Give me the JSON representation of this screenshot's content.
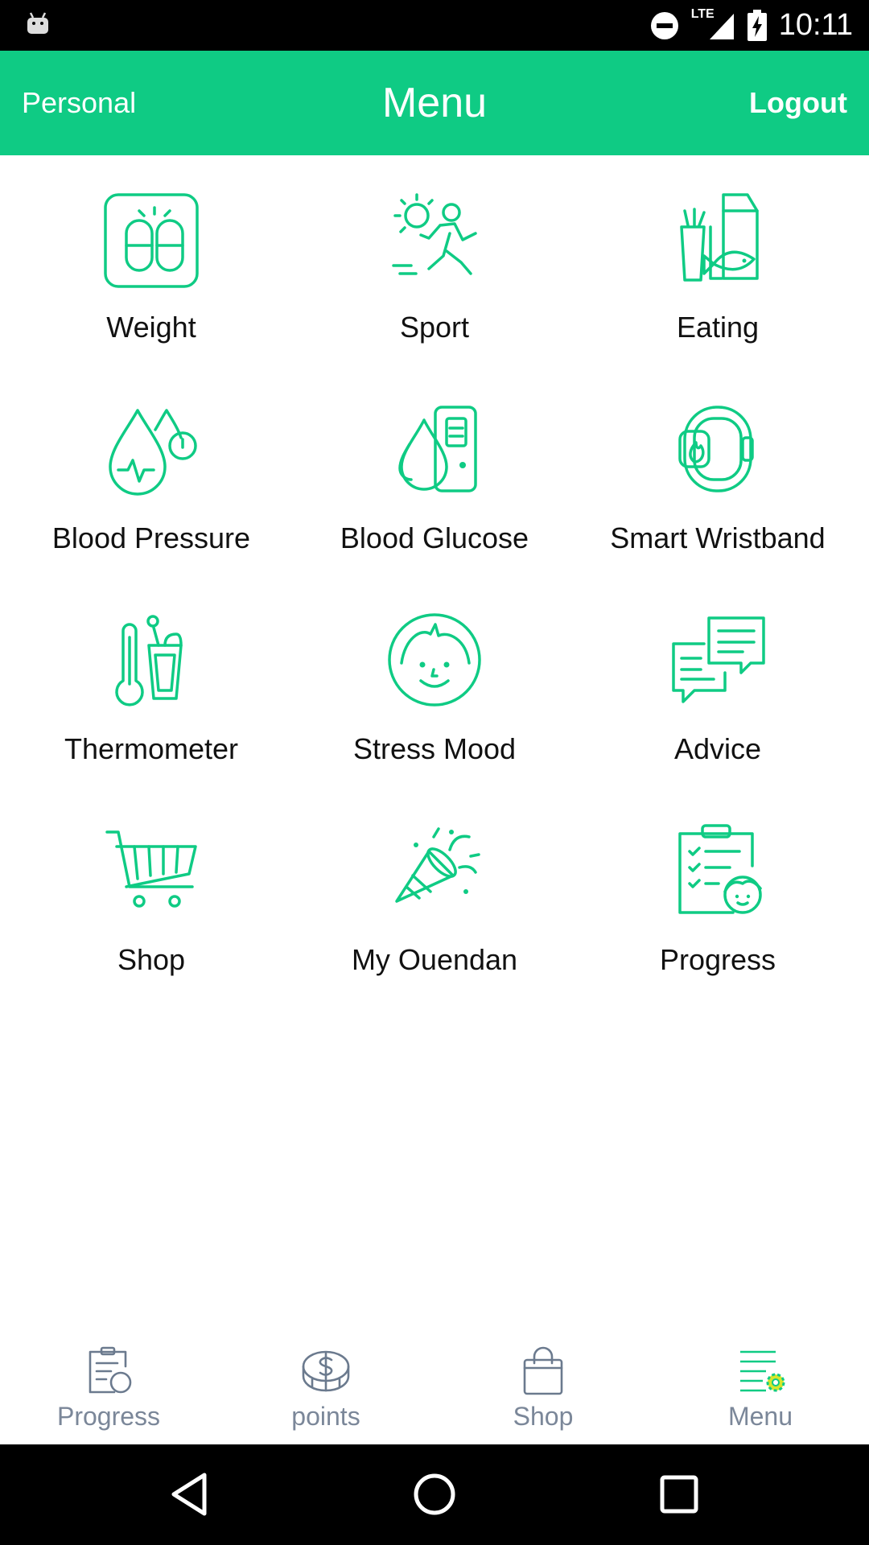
{
  "status_bar": {
    "time": "10:11",
    "network": "LTE"
  },
  "header": {
    "left_label": "Personal",
    "title": "Menu",
    "right_label": "Logout"
  },
  "menu_items": [
    {
      "label": "Weight",
      "icon": "scale-icon"
    },
    {
      "label": "Sport",
      "icon": "running-person-icon"
    },
    {
      "label": "Eating",
      "icon": "groceries-icon"
    },
    {
      "label": "Blood Pressure",
      "icon": "blood-pressure-icon"
    },
    {
      "label": "Blood Glucose",
      "icon": "glucose-meter-icon"
    },
    {
      "label": "Smart Wristband",
      "icon": "wristband-icon"
    },
    {
      "label": "Thermometer",
      "icon": "thermometer-icon"
    },
    {
      "label": "Stress Mood",
      "icon": "smiley-face-icon"
    },
    {
      "label": "Advice",
      "icon": "chat-bubbles-icon"
    },
    {
      "label": "Shop",
      "icon": "shopping-cart-icon"
    },
    {
      "label": "My Ouendan",
      "icon": "party-popper-icon"
    },
    {
      "label": "Progress",
      "icon": "clipboard-person-icon"
    }
  ],
  "bottom_nav": [
    {
      "label": "Progress",
      "icon": "clipboard-icon"
    },
    {
      "label": "points",
      "icon": "coin-icon"
    },
    {
      "label": "Shop",
      "icon": "bag-icon"
    },
    {
      "label": "Menu",
      "icon": "menu-gear-icon"
    }
  ],
  "colors": {
    "accent": "#0fcb84",
    "nav_gray": "#7b8799"
  }
}
